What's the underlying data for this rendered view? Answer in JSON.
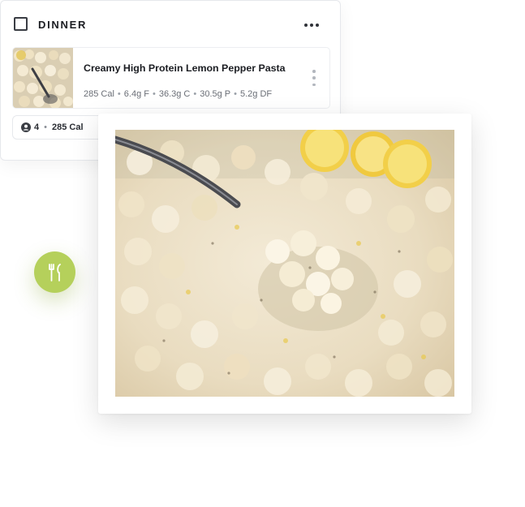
{
  "meal": {
    "title": "DINNER",
    "more_icon": "ellipsis-horizontal-icon",
    "recipe": {
      "name": "Creamy High Protein Lemon Pepper Pasta",
      "macros": [
        "285 Cal",
        "6.4g F",
        "36.3g C",
        "30.5g P",
        "5.2g DF"
      ],
      "more_icon": "ellipsis-vertical-icon"
    },
    "servings": {
      "icon": "person-icon",
      "count": "4",
      "calories": "285 Cal"
    }
  },
  "photo_icon": "utensils-icon",
  "colors": {
    "accent": "#b5d05b",
    "text": "#1b1d22",
    "muted": "#6a6e76",
    "border": "#e6e8ec"
  }
}
